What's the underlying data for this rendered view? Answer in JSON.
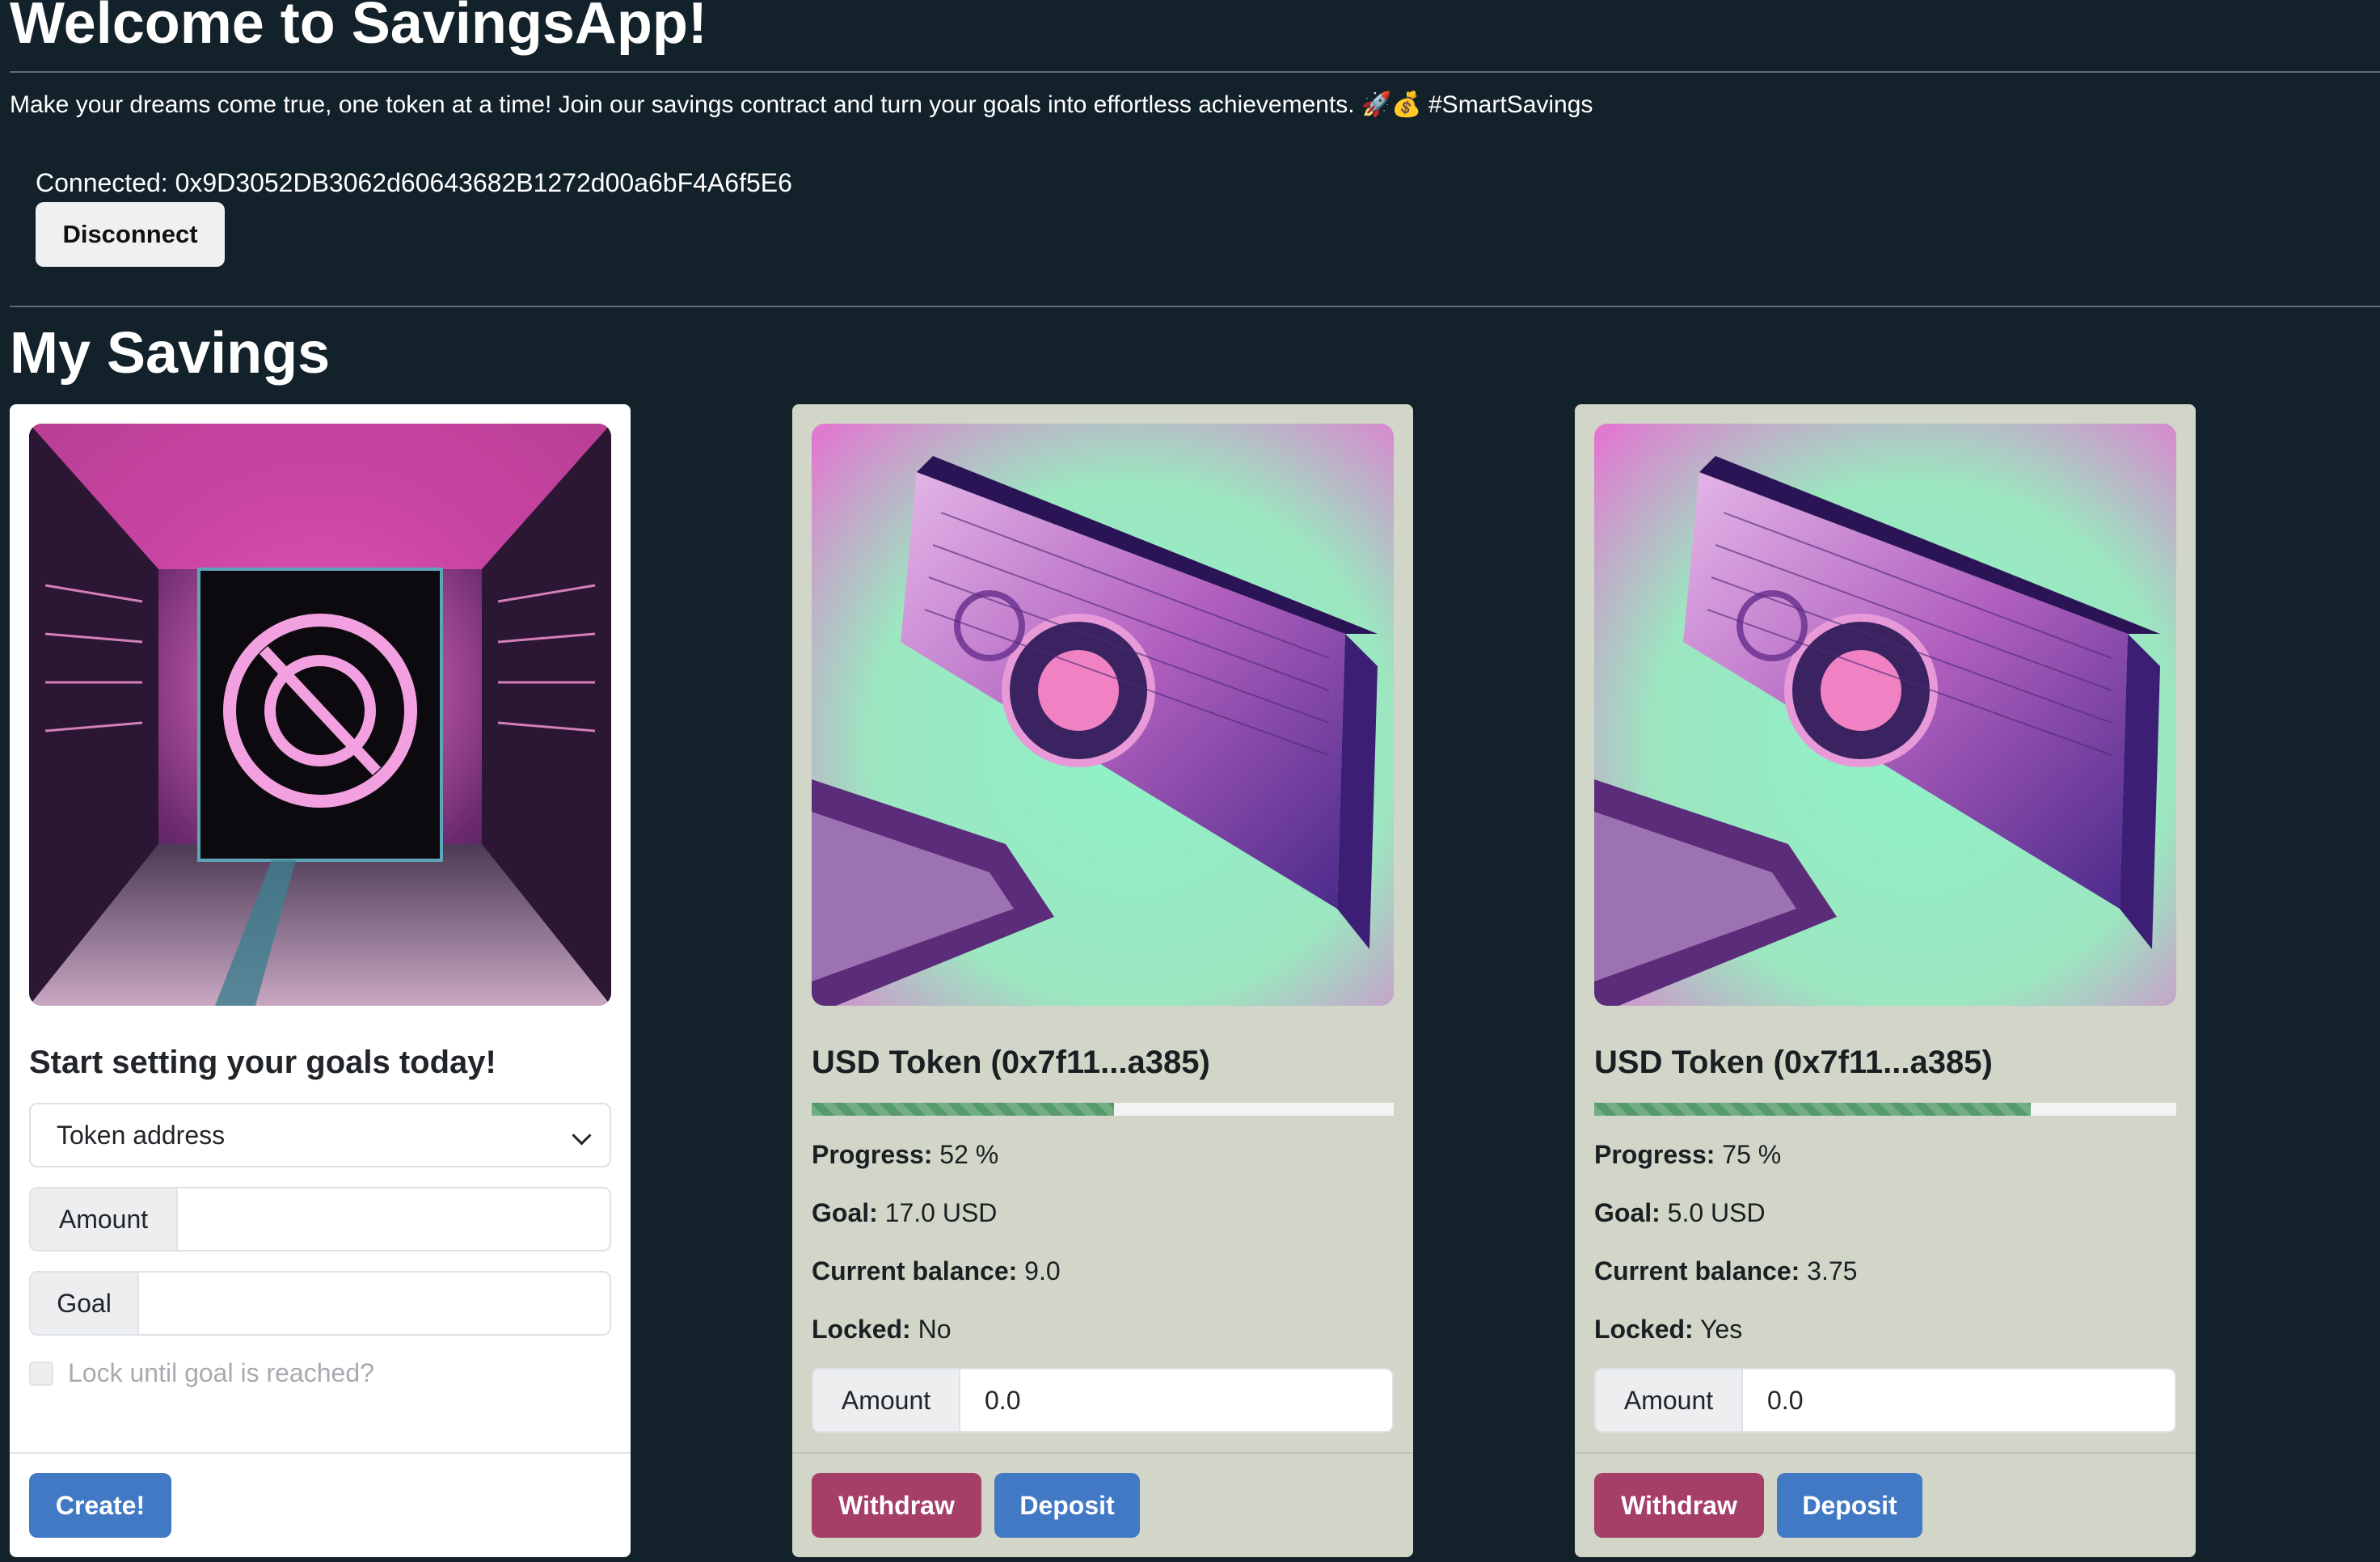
{
  "header": {
    "title": "Welcome to SavingsApp!",
    "tagline": "Make your dreams come true, one token at a time! Join our savings contract and turn your goals into effortless achievements. 🚀💰 #SmartSavings",
    "connected_label": "Connected:",
    "address": "0x9D3052DB3062d60643682B1272d00a6bF4A6f5E6",
    "disconnect_label": "Disconnect"
  },
  "savings": {
    "title": "My Savings",
    "create_card": {
      "heading": "Start setting your goals today!",
      "token_select": "Token address",
      "amount_label": "Amount",
      "goal_label": "Goal",
      "lock_label": "Lock until goal is reached?",
      "create_label": "Create!"
    },
    "cards": [
      {
        "title": "USD Token (0x7f11...a385)",
        "progress": 52,
        "progress_label": "Progress:",
        "progress_text": "52 %",
        "goal_label": "Goal:",
        "goal_text": "17.0 USD",
        "balance_label": "Current balance:",
        "balance_text": "9.0",
        "locked_label": "Locked:",
        "locked_text": "No",
        "amount_label": "Amount",
        "amount_value": "0.0",
        "withdraw_label": "Withdraw",
        "deposit_label": "Deposit"
      },
      {
        "title": "USD Token (0x7f11...a385)",
        "progress": 75,
        "progress_label": "Progress:",
        "progress_text": "75 %",
        "goal_label": "Goal:",
        "goal_text": "5.0 USD",
        "balance_label": "Current balance:",
        "balance_text": "3.75",
        "locked_label": "Locked:",
        "locked_text": "Yes",
        "amount_label": "Amount",
        "amount_value": "0.0",
        "withdraw_label": "Withdraw",
        "deposit_label": "Deposit"
      }
    ]
  },
  "colors": {
    "background": "#12212a",
    "card_sage": "#d1d6c8",
    "primary": "#4279c4",
    "withdraw": "#a63f67",
    "progress": "#559a6b"
  }
}
